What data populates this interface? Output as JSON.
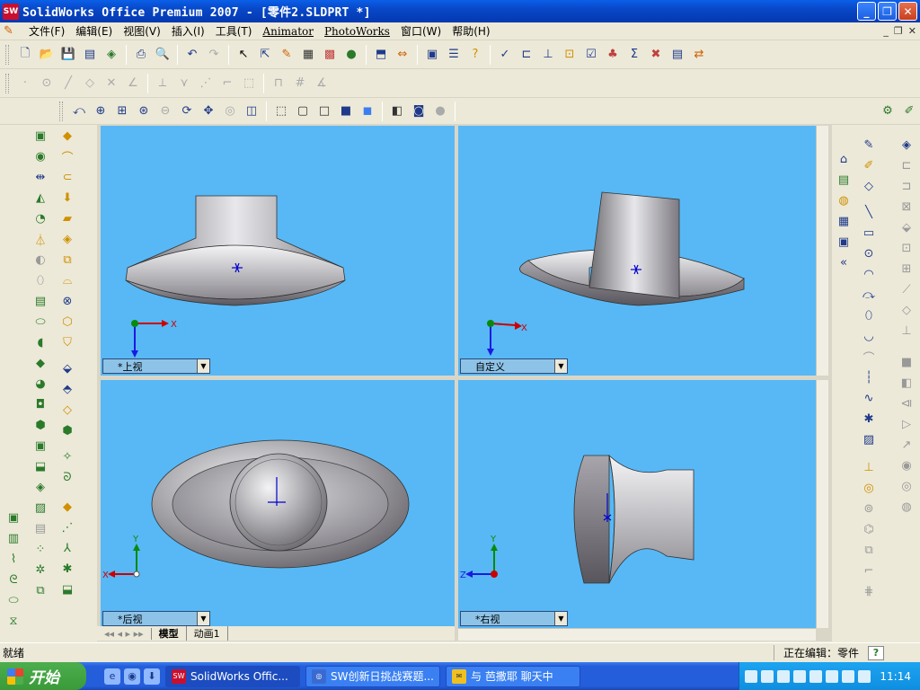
{
  "window": {
    "title": "SolidWorks Office Premium 2007 - [零件2.SLDPRT *]",
    "app_icon": "SW"
  },
  "menu": {
    "items": [
      "文件(F)",
      "编辑(E)",
      "视图(V)",
      "插入(I)",
      "工具(T)",
      "Animator",
      "PhotoWorks",
      "窗口(W)",
      "帮助(H)"
    ]
  },
  "viewports": [
    {
      "label": "*上视",
      "axis1": "X",
      "axis2": "Z"
    },
    {
      "label": "自定义",
      "axis1": "X",
      "axis2": "Z"
    },
    {
      "label": "*后视",
      "axis1": "X",
      "axis2": "Y"
    },
    {
      "label": "*右视",
      "axis1": "Z",
      "axis2": "Y"
    }
  ],
  "tabs": [
    "模型",
    "动画1"
  ],
  "status": {
    "left": "就绪",
    "right": "正在编辑：零件",
    "help": "?"
  },
  "taskbar": {
    "start": "开始",
    "tasks": [
      "SolidWorks Offic...",
      "SW创新日挑战赛题...",
      "与 芭撒耶 聊天中"
    ],
    "clock": "11:14"
  },
  "colors": {
    "viewport_bg": "#57b8f5",
    "titlebar": "#0848c8"
  }
}
